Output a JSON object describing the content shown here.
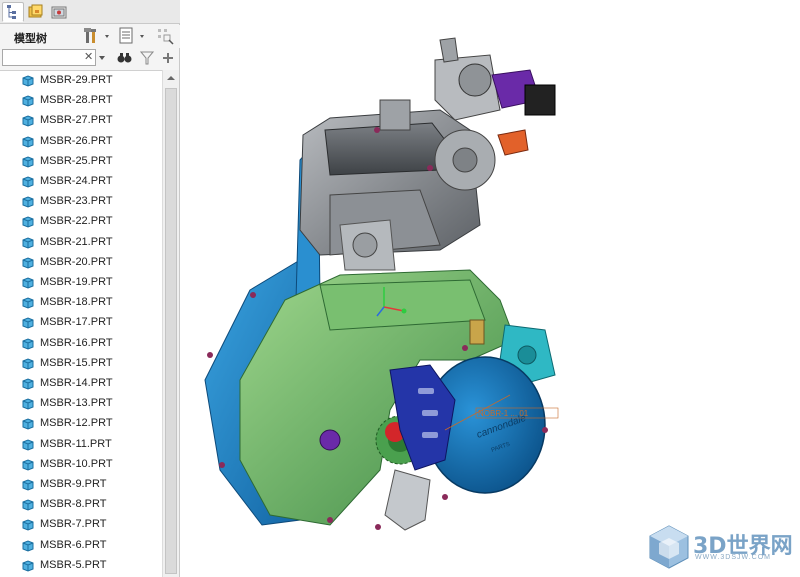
{
  "tabs": [
    {
      "icon": "model-tree-tab-icon"
    },
    {
      "icon": "folder-browser-tab-icon"
    },
    {
      "icon": "favorites-tab-icon"
    }
  ],
  "panel": {
    "title": "模型树",
    "search": {
      "value": "",
      "placeholder": ""
    }
  },
  "tree": {
    "items": [
      "MSBR-29.PRT",
      "MSBR-28.PRT",
      "MSBR-27.PRT",
      "MSBR-26.PRT",
      "MSBR-25.PRT",
      "MSBR-24.PRT",
      "MSBR-23.PRT",
      "MSBR-22.PRT",
      "MSBR-21.PRT",
      "MSBR-20.PRT",
      "MSBR-19.PRT",
      "MSBR-18.PRT",
      "MSBR-17.PRT",
      "MSBR-16.PRT",
      "MSBR-15.PRT",
      "MSBR-14.PRT",
      "MSBR-13.PRT",
      "MSBR-12.PRT",
      "MSBR-11.PRT",
      "MSBR-10.PRT",
      "MSBR-9.PRT",
      "MSBR-8.PRT",
      "MSBR-7.PRT",
      "MSBR-6.PRT",
      "MSBR-5.PRT"
    ]
  },
  "model": {
    "cover_text": "cannondale",
    "cover_subtext": "PARTS",
    "annotation": "NOBR-1 ... 01"
  },
  "watermark": {
    "title": "3D世界网",
    "subtitle": "WWW.3DSJW.COM"
  },
  "colors": {
    "crankcase_green": "#5ea85a",
    "cover_blue": "#1e88c8",
    "head_gray": "#8a8f94",
    "accent_purple": "#6a2aa8",
    "accent_orange": "#e2612a"
  }
}
